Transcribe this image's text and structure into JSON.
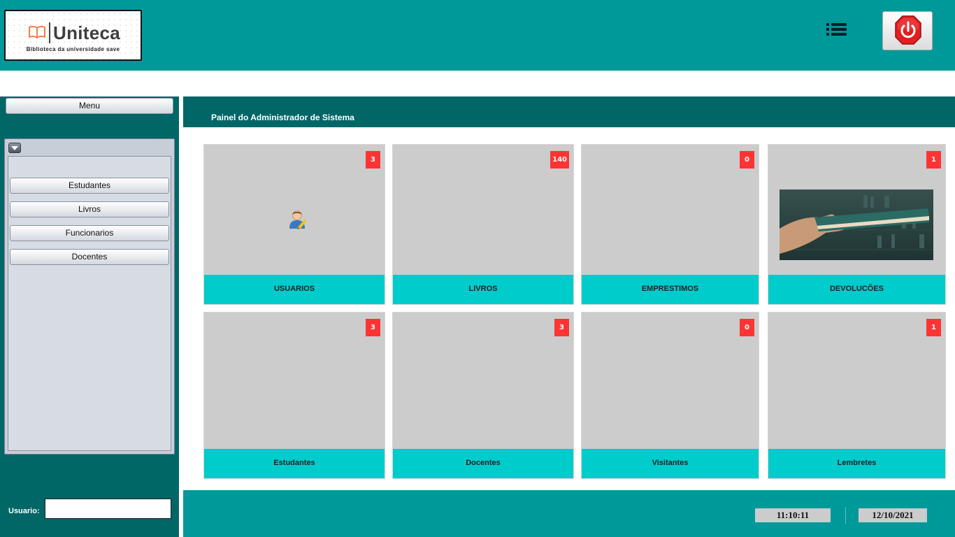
{
  "header": {
    "logo_name": "Uniteca",
    "logo_tagline": "Biblioteca da universidade save",
    "icons": {
      "menu": "list-icon",
      "power": "power-icon"
    },
    "colors": {
      "primary": "#009999",
      "dark": "#006666",
      "accent": "#00cccc",
      "badge": "#ff3333",
      "power": "#e02020"
    }
  },
  "sidebar": {
    "menu_label": "Menu",
    "items": [
      {
        "label": "Estudantes"
      },
      {
        "label": "Livros"
      },
      {
        "label": "Funcionarios"
      },
      {
        "label": "Docentes"
      }
    ],
    "user_label": "Usuario:",
    "user_value": ""
  },
  "main": {
    "title": "Painel do Administrador de Sistema",
    "tiles": [
      {
        "label": "USUARIOS",
        "count": "3"
      },
      {
        "label": "LIVROS",
        "count": "140"
      },
      {
        "label": "EMPRESTIMOS",
        "count": "0"
      },
      {
        "label": "DEVOLUCÕES",
        "count": "1"
      },
      {
        "label": "Estudantes",
        "count": "3"
      },
      {
        "label": "Docentes",
        "count": "3"
      },
      {
        "label": "Visitantes",
        "count": "0"
      },
      {
        "label": "Lembretes",
        "count": "1"
      }
    ]
  },
  "footer": {
    "time": "11:10:11",
    "date": "12/10/2021"
  }
}
